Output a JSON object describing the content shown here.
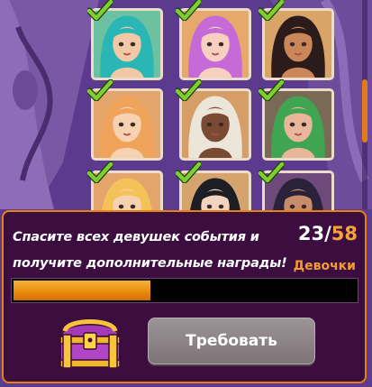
{
  "event": {
    "task_text": "Спасите всех девушек события и получите дополнительные награды!",
    "counter": {
      "current": "23",
      "separator": "/",
      "total": "58"
    },
    "category": "Девочки",
    "progress": 0.397,
    "claim_label": "Требовать"
  },
  "colors": {
    "accent": "#f59b2f",
    "panel_bg": "#3b0e3f",
    "check": "#6fc22a",
    "button": "#8a8185"
  },
  "icons": [
    "check-icon",
    "treasure-chest-icon"
  ],
  "girls": [
    {
      "collected": true,
      "hair": "#2bb6b6",
      "skin": "#f2c9a6",
      "bg": "#6cc2a0"
    },
    {
      "collected": true,
      "hair": "#c56ad6",
      "skin": "#f7d0c0",
      "bg": "#e7a96b"
    },
    {
      "collected": true,
      "hair": "#2b1b1a",
      "skin": "#c9875a",
      "bg": "#d8a468"
    },
    {
      "collected": true,
      "hair": "#f0a35a",
      "skin": "#f6d2b0",
      "bg": "#e3a56b"
    },
    {
      "collected": true,
      "hair": "#ece6da",
      "skin": "#7a4a32",
      "bg": "#d59e67"
    },
    {
      "collected": true,
      "hair": "#3fa552",
      "skin": "#e8b69a",
      "bg": "#7a6a55"
    },
    {
      "collected": true,
      "hair": "#f3c35a",
      "skin": "#f6d2b0",
      "bg": "#e3a56b"
    },
    {
      "collected": true,
      "hair": "#1d1d24",
      "skin": "#f2d4c0",
      "bg": "#d5a46e"
    },
    {
      "collected": true,
      "hair": "#2a2238",
      "skin": "#c98c6a",
      "bg": "#6e4a7a"
    }
  ]
}
